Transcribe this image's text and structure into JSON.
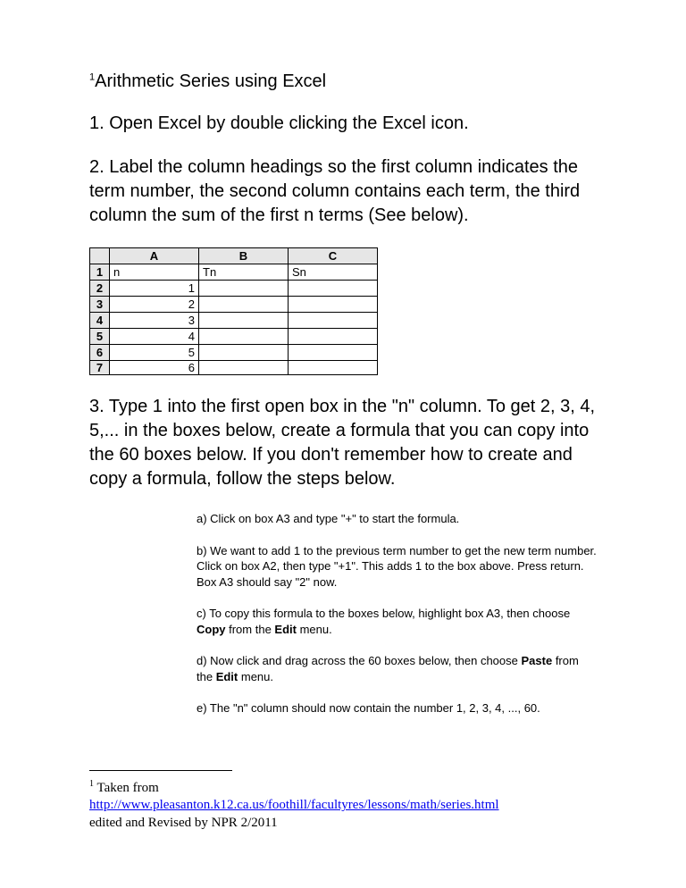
{
  "title": {
    "sup": "1",
    "text": "Arithmetic Series using Excel"
  },
  "steps": {
    "s1": "1. Open Excel by double clicking the Excel icon.",
    "s2": "2. Label the column headings so the first column indicates the term number, the second column contains each term, the third column the sum of the first n terms (See below).",
    "s3": "3. Type 1 into the first open box in the \"n\" column. To get 2, 3, 4, 5,... in the boxes below, create a formula that you can copy into the 60 boxes below. If you don't remember how to create and copy a formula, follow the steps below."
  },
  "sheet": {
    "cols": [
      "A",
      "B",
      "C"
    ],
    "rows": [
      "1",
      "2",
      "3",
      "4",
      "5",
      "6",
      "7"
    ],
    "cells": {
      "A1": "n",
      "B1": "Tn",
      "C1": "Sn",
      "A2": "1",
      "A3": "2",
      "A4": "3",
      "A5": "4",
      "A6": "5",
      "A7": "6"
    }
  },
  "sub": {
    "a": "a) Click on box A3 and type \"+\" to start the formula.",
    "b": "b) We want to add 1 to the previous term number to get the new term number. Click on box A2, then type \"+1\". This adds 1 to the box above. Press return. Box A3 should say \"2\" now.",
    "c_pre": "c) To copy this formula to the boxes below, highlight box A3, then choose ",
    "c_copy": "Copy",
    "c_mid": " from the ",
    "c_edit": "Edit",
    "c_post": " menu.",
    "d_pre": "d) Now click and drag across the 60 boxes below, then choose ",
    "d_paste": "Paste",
    "d_mid": " from the ",
    "d_edit": "Edit",
    "d_post": " menu.",
    "e": "e) The \"n\" column should now contain the number 1, 2, 3, 4, ..., 60."
  },
  "footnote": {
    "sup": "1",
    "taken": " Taken from",
    "url": "http://www.pleasanton.k12.ca.us/foothill/facultyres/lessons/math/series.html",
    "edited": "edited and Revised by NPR 2/2011"
  }
}
